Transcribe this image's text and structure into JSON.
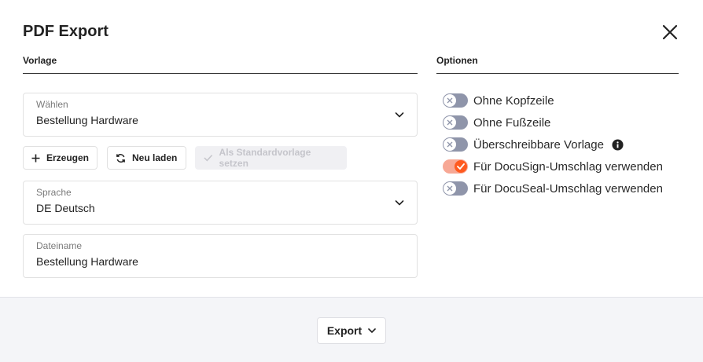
{
  "dialog": {
    "title": "PDF Export"
  },
  "vorlage": {
    "heading": "Vorlage",
    "select": {
      "label": "Wählen",
      "value": "Bestellung Hardware"
    },
    "buttons": {
      "create": "Erzeugen",
      "reload": "Neu laden",
      "set_default": "Als Standardvorlage setzen"
    },
    "language": {
      "label": "Sprache",
      "value": "DE Deutsch"
    },
    "filename": {
      "label": "Dateiname",
      "value": "Bestellung Hardware"
    }
  },
  "optionen": {
    "heading": "Optionen",
    "items": [
      {
        "label": "Ohne Kopfzeile",
        "on": false
      },
      {
        "label": "Ohne Fußzeile",
        "on": false
      },
      {
        "label": "Überschreibbare Vorlage",
        "on": false,
        "info": true
      },
      {
        "label": "Für DocuSign-Umschlag verwenden",
        "on": true
      },
      {
        "label": "Für DocuSeal-Umschlag verwenden",
        "on": false
      }
    ]
  },
  "footer": {
    "export_label": "Export"
  },
  "icons": {
    "close": "close-icon",
    "dropdown": "chevron-down-icon",
    "create": "plus-icon",
    "reload": "refresh-icon",
    "set_default": "check-icon",
    "toggle_off": "x-icon",
    "toggle_on": "check-icon",
    "info": "info-icon"
  },
  "colors": {
    "toggle_off": "#8f95aa",
    "toggle_on_track": "#f7a895",
    "toggle_on_knob": "#ff5a1f",
    "footer_bg": "#f4f5f8"
  }
}
